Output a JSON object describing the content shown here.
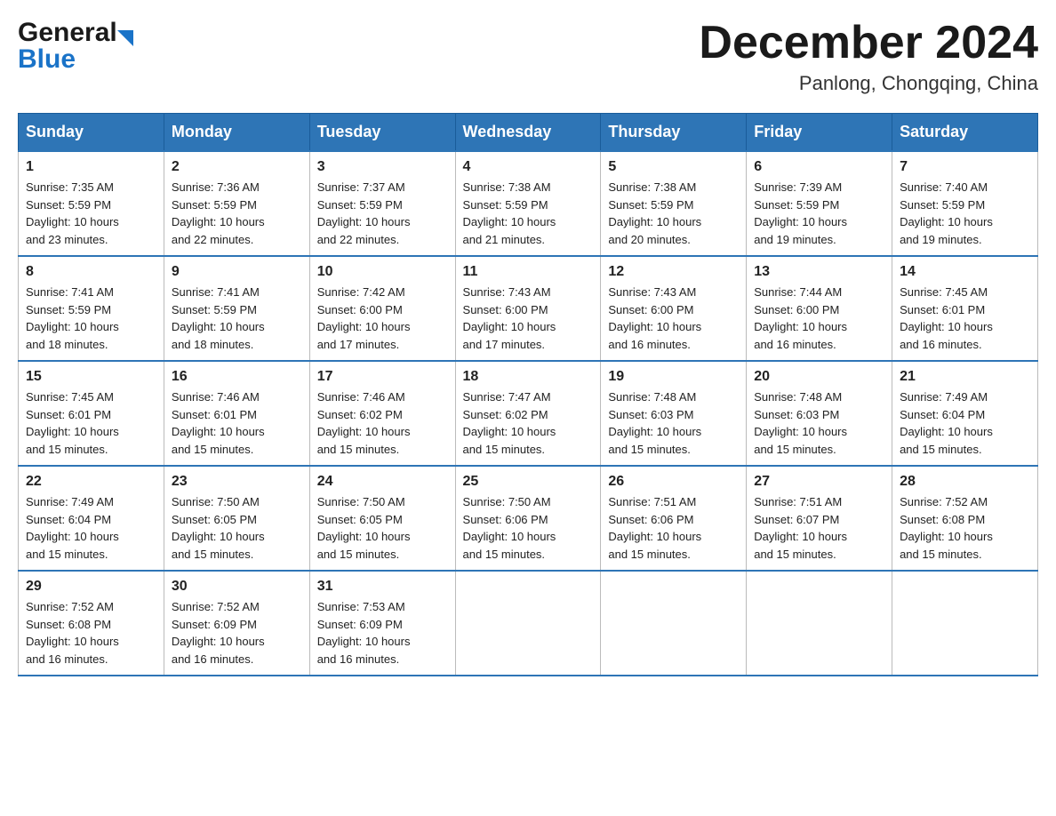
{
  "logo": {
    "general": "General",
    "blue": "Blue"
  },
  "title": {
    "month": "December 2024",
    "location": "Panlong, Chongqing, China"
  },
  "weekdays": [
    "Sunday",
    "Monday",
    "Tuesday",
    "Wednesday",
    "Thursday",
    "Friday",
    "Saturday"
  ],
  "weeks": [
    [
      {
        "day": "1",
        "sunrise": "7:35 AM",
        "sunset": "5:59 PM",
        "daylight": "10 hours and 23 minutes."
      },
      {
        "day": "2",
        "sunrise": "7:36 AM",
        "sunset": "5:59 PM",
        "daylight": "10 hours and 22 minutes."
      },
      {
        "day": "3",
        "sunrise": "7:37 AM",
        "sunset": "5:59 PM",
        "daylight": "10 hours and 22 minutes."
      },
      {
        "day": "4",
        "sunrise": "7:38 AM",
        "sunset": "5:59 PM",
        "daylight": "10 hours and 21 minutes."
      },
      {
        "day": "5",
        "sunrise": "7:38 AM",
        "sunset": "5:59 PM",
        "daylight": "10 hours and 20 minutes."
      },
      {
        "day": "6",
        "sunrise": "7:39 AM",
        "sunset": "5:59 PM",
        "daylight": "10 hours and 19 minutes."
      },
      {
        "day": "7",
        "sunrise": "7:40 AM",
        "sunset": "5:59 PM",
        "daylight": "10 hours and 19 minutes."
      }
    ],
    [
      {
        "day": "8",
        "sunrise": "7:41 AM",
        "sunset": "5:59 PM",
        "daylight": "10 hours and 18 minutes."
      },
      {
        "day": "9",
        "sunrise": "7:41 AM",
        "sunset": "5:59 PM",
        "daylight": "10 hours and 18 minutes."
      },
      {
        "day": "10",
        "sunrise": "7:42 AM",
        "sunset": "6:00 PM",
        "daylight": "10 hours and 17 minutes."
      },
      {
        "day": "11",
        "sunrise": "7:43 AM",
        "sunset": "6:00 PM",
        "daylight": "10 hours and 17 minutes."
      },
      {
        "day": "12",
        "sunrise": "7:43 AM",
        "sunset": "6:00 PM",
        "daylight": "10 hours and 16 minutes."
      },
      {
        "day": "13",
        "sunrise": "7:44 AM",
        "sunset": "6:00 PM",
        "daylight": "10 hours and 16 minutes."
      },
      {
        "day": "14",
        "sunrise": "7:45 AM",
        "sunset": "6:01 PM",
        "daylight": "10 hours and 16 minutes."
      }
    ],
    [
      {
        "day": "15",
        "sunrise": "7:45 AM",
        "sunset": "6:01 PM",
        "daylight": "10 hours and 15 minutes."
      },
      {
        "day": "16",
        "sunrise": "7:46 AM",
        "sunset": "6:01 PM",
        "daylight": "10 hours and 15 minutes."
      },
      {
        "day": "17",
        "sunrise": "7:46 AM",
        "sunset": "6:02 PM",
        "daylight": "10 hours and 15 minutes."
      },
      {
        "day": "18",
        "sunrise": "7:47 AM",
        "sunset": "6:02 PM",
        "daylight": "10 hours and 15 minutes."
      },
      {
        "day": "19",
        "sunrise": "7:48 AM",
        "sunset": "6:03 PM",
        "daylight": "10 hours and 15 minutes."
      },
      {
        "day": "20",
        "sunrise": "7:48 AM",
        "sunset": "6:03 PM",
        "daylight": "10 hours and 15 minutes."
      },
      {
        "day": "21",
        "sunrise": "7:49 AM",
        "sunset": "6:04 PM",
        "daylight": "10 hours and 15 minutes."
      }
    ],
    [
      {
        "day": "22",
        "sunrise": "7:49 AM",
        "sunset": "6:04 PM",
        "daylight": "10 hours and 15 minutes."
      },
      {
        "day": "23",
        "sunrise": "7:50 AM",
        "sunset": "6:05 PM",
        "daylight": "10 hours and 15 minutes."
      },
      {
        "day": "24",
        "sunrise": "7:50 AM",
        "sunset": "6:05 PM",
        "daylight": "10 hours and 15 minutes."
      },
      {
        "day": "25",
        "sunrise": "7:50 AM",
        "sunset": "6:06 PM",
        "daylight": "10 hours and 15 minutes."
      },
      {
        "day": "26",
        "sunrise": "7:51 AM",
        "sunset": "6:06 PM",
        "daylight": "10 hours and 15 minutes."
      },
      {
        "day": "27",
        "sunrise": "7:51 AM",
        "sunset": "6:07 PM",
        "daylight": "10 hours and 15 minutes."
      },
      {
        "day": "28",
        "sunrise": "7:52 AM",
        "sunset": "6:08 PM",
        "daylight": "10 hours and 15 minutes."
      }
    ],
    [
      {
        "day": "29",
        "sunrise": "7:52 AM",
        "sunset": "6:08 PM",
        "daylight": "10 hours and 16 minutes."
      },
      {
        "day": "30",
        "sunrise": "7:52 AM",
        "sunset": "6:09 PM",
        "daylight": "10 hours and 16 minutes."
      },
      {
        "day": "31",
        "sunrise": "7:53 AM",
        "sunset": "6:09 PM",
        "daylight": "10 hours and 16 minutes."
      },
      null,
      null,
      null,
      null
    ]
  ],
  "labels": {
    "sunrise": "Sunrise:",
    "sunset": "Sunset:",
    "daylight": "Daylight:"
  },
  "accent_color": "#2e75b6"
}
